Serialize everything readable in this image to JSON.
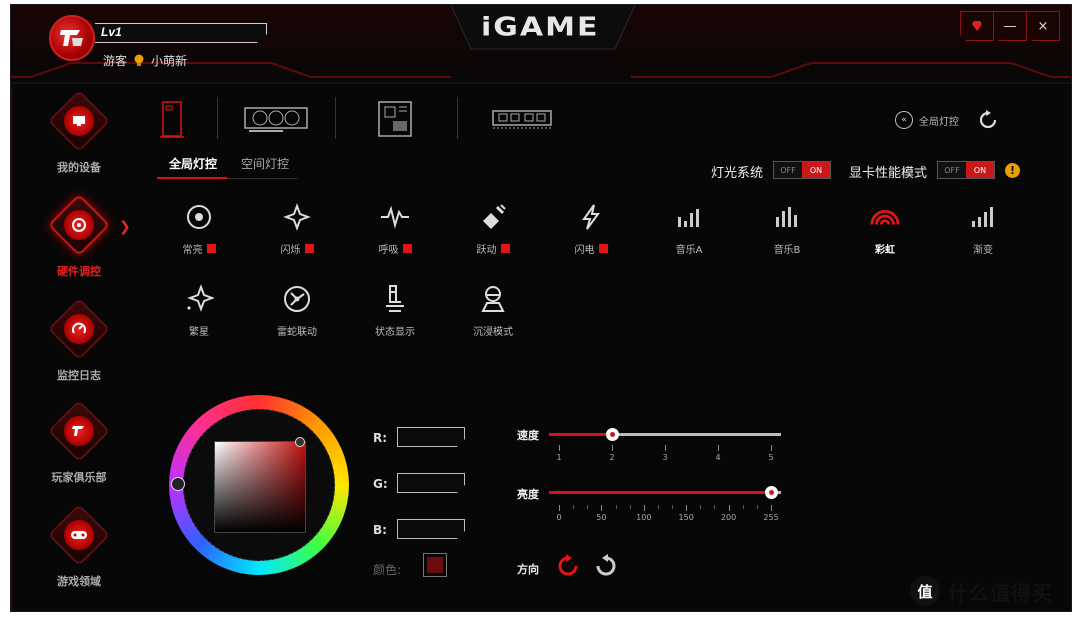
{
  "header": {
    "level": "Lv1",
    "user_role": "游客",
    "user_name": "小萌新",
    "logo": "iGAME",
    "window_buttons": [
      "gem-icon",
      "minimize-icon",
      "close-icon"
    ]
  },
  "sidebar": {
    "items": [
      {
        "label": "我的设备",
        "icon": "monitor-icon",
        "active": false
      },
      {
        "label": "硬件调控",
        "icon": "gamepad-dial-icon",
        "active": true
      },
      {
        "label": "监控日志",
        "icon": "gauge-icon",
        "active": false
      },
      {
        "label": "玩家俱乐部",
        "icon": "igame-logo-icon",
        "active": false
      },
      {
        "label": "游戏领域",
        "icon": "controller-icon",
        "active": false
      }
    ]
  },
  "devices": {
    "items": [
      "pc-case-icon",
      "graphics-card-icon",
      "motherboard-icon",
      "memory-icon"
    ],
    "active_index": 0
  },
  "global_light": {
    "label": "全局灯控"
  },
  "subtabs": {
    "items": [
      "全局灯控",
      "空间灯控"
    ],
    "active_index": 0
  },
  "toggles": [
    {
      "label": "灯光系统",
      "off": "OFF",
      "on": "ON",
      "state": "on"
    },
    {
      "label": "显卡性能模式",
      "off": "OFF",
      "on": "ON",
      "state": "on"
    }
  ],
  "effects": [
    {
      "label": "常亮",
      "icon": "target-icon",
      "swatch": true
    },
    {
      "label": "闪烁",
      "icon": "flash-star-icon",
      "swatch": true
    },
    {
      "label": "呼吸",
      "icon": "pulse-icon",
      "swatch": true
    },
    {
      "label": "跃动",
      "icon": "bounce-icon",
      "swatch": true
    },
    {
      "label": "闪电",
      "icon": "lightning-icon",
      "swatch": true
    },
    {
      "label": "音乐A",
      "icon": "equalizer-a-icon",
      "swatch": false
    },
    {
      "label": "音乐B",
      "icon": "equalizer-b-icon",
      "swatch": false
    },
    {
      "label": "彩虹",
      "icon": "rainbow-icon",
      "swatch": false,
      "active": true
    },
    {
      "label": "渐变",
      "icon": "gradient-bars-icon",
      "swatch": false
    },
    {
      "label": "繁星",
      "icon": "stars-icon",
      "swatch": false
    },
    {
      "label": "雷蛇联动",
      "icon": "razer-link-icon",
      "swatch": false
    },
    {
      "label": "状态显示",
      "icon": "status-icon",
      "swatch": false
    },
    {
      "label": "沉浸模式",
      "icon": "immersive-icon",
      "swatch": false
    }
  ],
  "color": {
    "r_label": "R:",
    "g_label": "G:",
    "b_label": "B:",
    "r_value": "",
    "g_value": "",
    "b_value": "",
    "color_label": "颜色:",
    "swatch_color": "#6e0b0b"
  },
  "speed": {
    "label": "速度",
    "ticks": [
      "1",
      "2",
      "3",
      "4",
      "5"
    ],
    "value": 2,
    "min": 1,
    "max": 5
  },
  "brightness": {
    "label": "亮度",
    "ticks": [
      "0",
      "50",
      "100",
      "150",
      "200",
      "255"
    ],
    "value": 255,
    "min": 0,
    "max": 255
  },
  "direction": {
    "label": "方向"
  },
  "watermark": {
    "glyph": "值",
    "text": "什么值得买"
  },
  "colors": {
    "accent": "#d11515",
    "bg": "#070707"
  }
}
